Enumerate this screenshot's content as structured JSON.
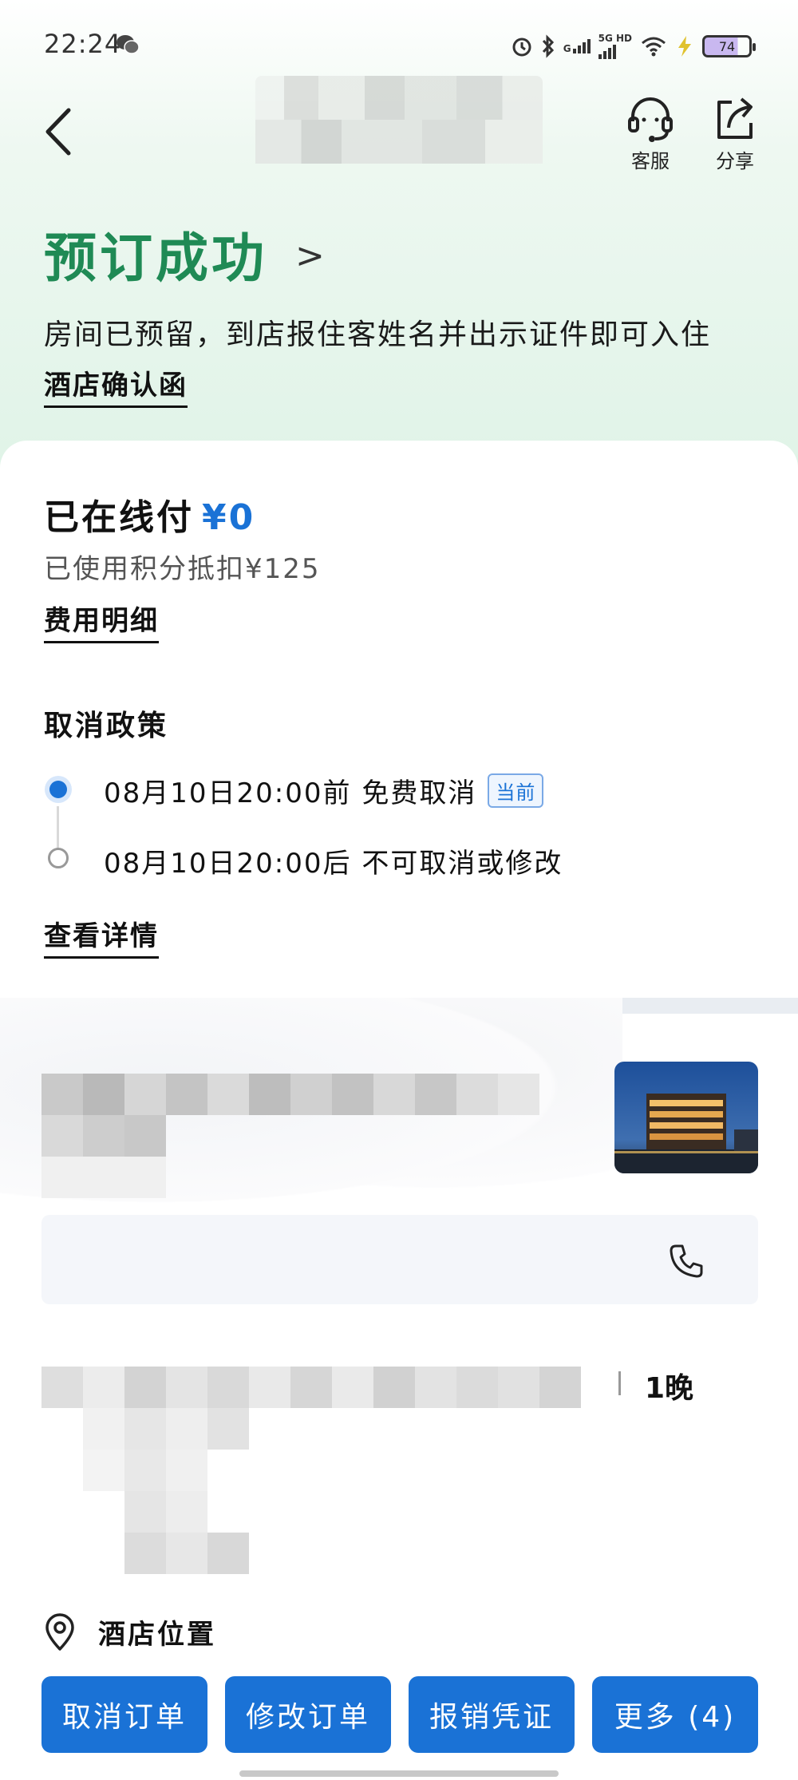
{
  "status_bar": {
    "time": "22:24",
    "network_top": "5G HD",
    "network_g": "G",
    "battery": "74"
  },
  "header": {
    "service_label": "客服",
    "share_label": "分享"
  },
  "success": {
    "title": "预订成功",
    "chevron": ">",
    "description": "房间已预留，到店报住客姓名并出示证件即可入住",
    "confirm_link": "酒店确认函"
  },
  "payment": {
    "paid_label": "已在线付",
    "paid_amount": "¥0",
    "points_text": "已使用积分抵扣¥125",
    "fee_link": "费用明细"
  },
  "cancel_policy": {
    "title": "取消政策",
    "items": [
      {
        "text": "08月10日20:00前 免费取消",
        "tag": "当前"
      },
      {
        "text": "08月10日20:00后 不可取消或修改"
      }
    ],
    "details_link": "查看详情"
  },
  "hotel": {
    "nights_text": "1晚",
    "location_label": "酒店位置"
  },
  "bottom_actions": {
    "cancel_order": "取消订单",
    "modify_order": "修改订单",
    "invoice": "报销凭证",
    "more": "更多 (4)"
  },
  "colors": {
    "accent_blue": "#1a72d6",
    "success_green": "#1f8a55"
  }
}
